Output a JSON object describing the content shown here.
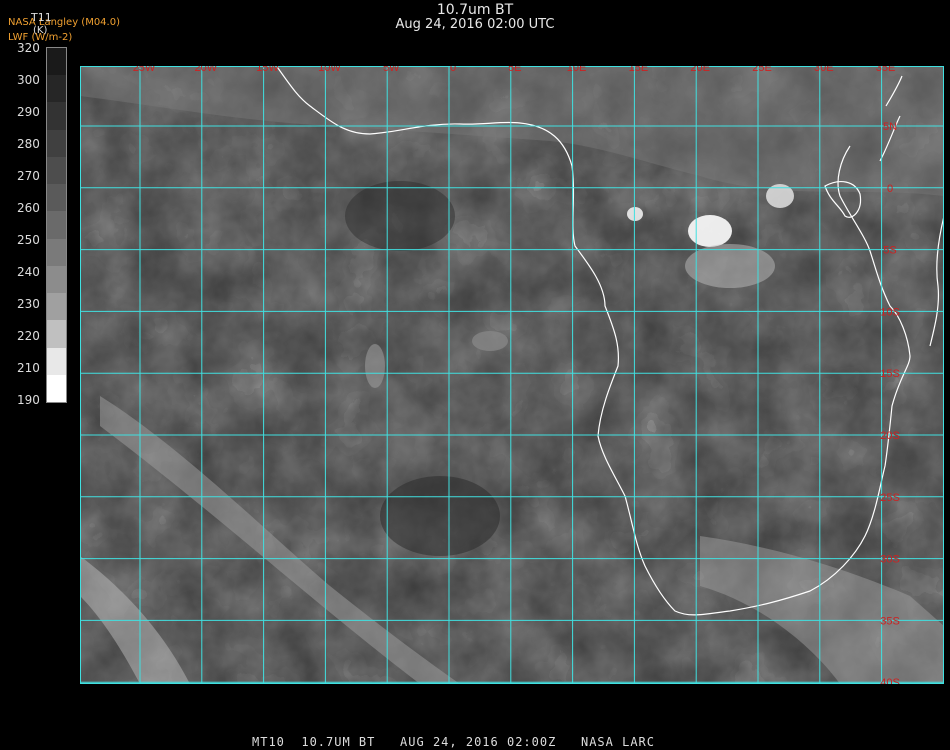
{
  "header": {
    "title": "10.7um BT",
    "subtitle": "Aug 24, 2016 02:00 UTC",
    "credit_line1": "NASA Langley (M04.0)",
    "credit_line2": "LWF (W/m-2)",
    "legend_title": "T11",
    "legend_unit": "(K)"
  },
  "colorbar": {
    "ticks": [
      "320",
      "300",
      "290",
      "280",
      "270",
      "260",
      "250",
      "240",
      "230",
      "220",
      "210",
      "190"
    ],
    "colors": [
      "#1a1a1a",
      "#262626",
      "#333333",
      "#404040",
      "#4d4d4d",
      "#5a5a5a",
      "#6a6a6a",
      "#7a7a7a",
      "#8c8c8c",
      "#a0a0a0",
      "#c0c0c0",
      "#e8e8e8",
      "#ffffff"
    ]
  },
  "map": {
    "lon_labels": [
      "25W",
      "20W",
      "15W",
      "10W",
      "5W",
      "0",
      "5E",
      "10E",
      "15E",
      "20E",
      "25E",
      "30E",
      "35E"
    ],
    "lat_labels": [
      "5N",
      "0",
      "5S",
      "10S",
      "15S",
      "20S",
      "25S",
      "30S",
      "35S",
      "40S"
    ],
    "grid_color": "#40e0e0",
    "coast_color": "#ffffff",
    "label_color": "#cc2222"
  },
  "footer": {
    "text": "MT10  10.7UM BT   AUG 24, 2016 02:00Z   NASA LARC"
  }
}
